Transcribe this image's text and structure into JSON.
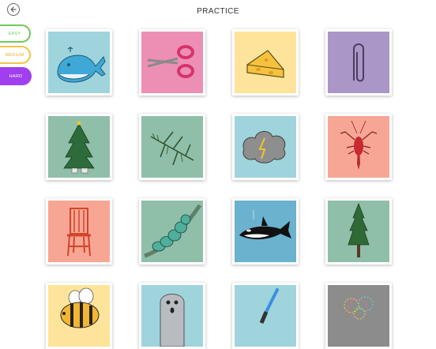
{
  "header": {
    "title": "PRACTICE",
    "back_icon": "back-arrow-icon"
  },
  "difficulty": {
    "levels": [
      {
        "label": "EASY",
        "color": "#6fca59",
        "selected": false
      },
      {
        "label": "MEDIUM",
        "color": "#f4c347",
        "selected": false
      },
      {
        "label": "HARD",
        "color": "#a03ff0",
        "selected": true
      }
    ]
  },
  "cards": [
    {
      "picture": "whale",
      "bg": "#9fd4dc"
    },
    {
      "picture": "scissors",
      "bg": "#ed8fb4"
    },
    {
      "picture": "cheese",
      "bg": "#fde49a"
    },
    {
      "picture": "paper-clip",
      "bg": "#ab97c7"
    },
    {
      "picture": "christmas-tree",
      "bg": "#8fbfa9"
    },
    {
      "picture": "pine-branch",
      "bg": "#8fbfa9"
    },
    {
      "picture": "storm-cloud",
      "bg": "#9fd4dc"
    },
    {
      "picture": "lobster",
      "bg": "#f7a694"
    },
    {
      "picture": "chair",
      "bg": "#f7a694"
    },
    {
      "picture": "caterpillar",
      "bg": "#8fbfa9"
    },
    {
      "picture": "orca",
      "bg": "#6ab2cd"
    },
    {
      "picture": "tree",
      "bg": "#8fbfa9"
    },
    {
      "picture": "bee",
      "bg": "#fde49a"
    },
    {
      "picture": "ghost",
      "bg": "#9fd4dc"
    },
    {
      "picture": "lightsaber",
      "bg": "#9fd4dc"
    },
    {
      "picture": "fireworks",
      "bg": "#8c8c8c"
    }
  ]
}
